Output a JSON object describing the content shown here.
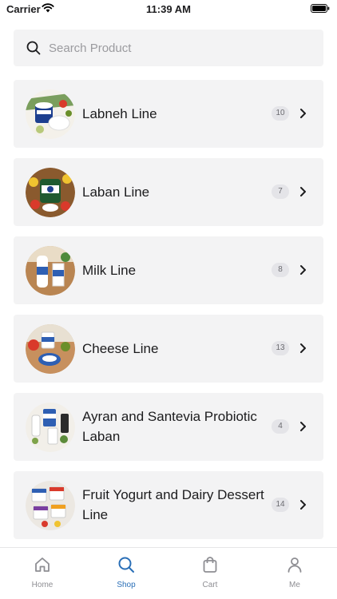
{
  "status_bar": {
    "carrier": "Carrier",
    "time": "11:39 AM"
  },
  "search": {
    "placeholder": "Search Product",
    "value": ""
  },
  "categories": [
    {
      "label": "Labneh Line",
      "count": "10"
    },
    {
      "label": "Laban Line",
      "count": "7"
    },
    {
      "label": "Milk Line",
      "count": "8"
    },
    {
      "label": "Cheese Line",
      "count": "13"
    },
    {
      "label": "Ayran and Santevia Probiotic Laban",
      "count": "4"
    },
    {
      "label": "Fruit Yogurt and Dairy Dessert Line",
      "count": "14"
    }
  ],
  "tab_bar": {
    "tabs": [
      {
        "label": "Home",
        "icon": "home-icon"
      },
      {
        "label": "Shop",
        "icon": "search-icon"
      },
      {
        "label": "Cart",
        "icon": "bag-icon"
      },
      {
        "label": "Me",
        "icon": "person-icon"
      }
    ],
    "active": "Shop",
    "active_color": "#2a6fb7",
    "inactive_color": "#8e8e93"
  }
}
